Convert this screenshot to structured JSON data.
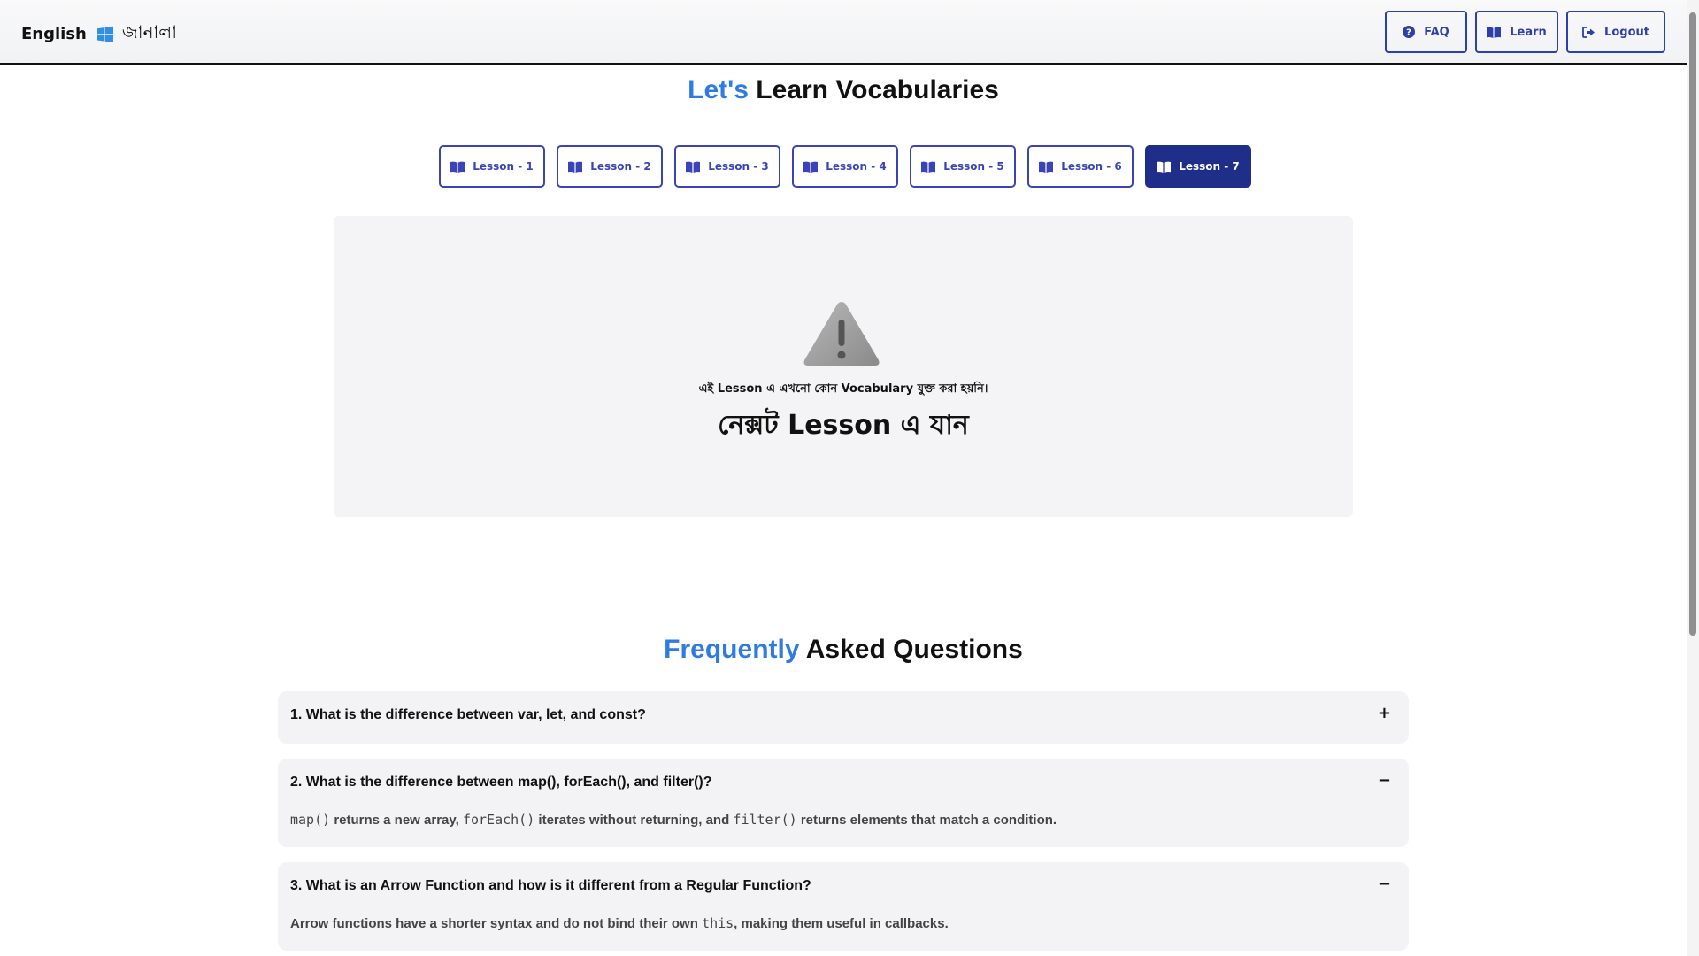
{
  "navbar": {
    "brand_left": "English",
    "brand_right": "জানালা",
    "buttons": [
      {
        "label": "FAQ",
        "icon": "question-circle-icon"
      },
      {
        "label": "Learn",
        "icon": "book-open-icon"
      },
      {
        "label": "Logout",
        "icon": "logout-icon"
      }
    ]
  },
  "vocab_heading": {
    "accent": "Let's",
    "rest": " Learn Vocabularies"
  },
  "lessons": [
    {
      "label": "Lesson - 1",
      "active": false
    },
    {
      "label": "Lesson - 2",
      "active": false
    },
    {
      "label": "Lesson - 3",
      "active": false
    },
    {
      "label": "Lesson - 4",
      "active": false
    },
    {
      "label": "Lesson - 5",
      "active": false
    },
    {
      "label": "Lesson - 6",
      "active": false
    },
    {
      "label": "Lesson - 7",
      "active": true
    }
  ],
  "empty_state": {
    "message": "এই Lesson এ এখনো কোন Vocabulary যুক্ত করা হয়নি।",
    "next": "নেক্সট Lesson এ যান"
  },
  "faq_heading": {
    "accent": "Frequently",
    "rest": " Asked Questions"
  },
  "faq": [
    {
      "question": "1. What is the difference between var, let, and const?",
      "toggle": "+",
      "answer": null
    },
    {
      "question": "2. What is the difference between map(), forEach(), and filter()?",
      "toggle": "−",
      "answer": {
        "code1": "map()",
        "t1": " returns a new array, ",
        "code2": "forEach()",
        "t2": " iterates without returning, and ",
        "code3": "filter()",
        "t3": " returns elements that match a condition."
      }
    },
    {
      "question": "3. What is an Arrow Function and how is it different from a Regular Function?",
      "toggle": "−",
      "answer": {
        "t1": "Arrow functions have a shorter syntax and do not bind their own ",
        "code1": "this",
        "t2": ", making them useful in callbacks."
      }
    }
  ],
  "colors": {
    "accent": "#2f7be4",
    "primary": "#3b44b6",
    "primary_dark": "#1f2f89",
    "panel_bg": "#f4f4f6"
  }
}
